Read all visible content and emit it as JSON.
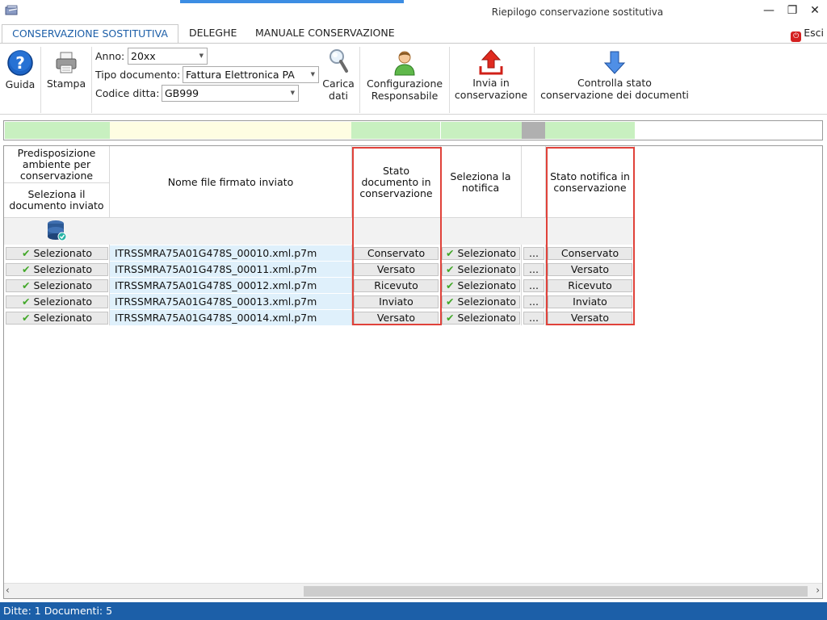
{
  "window": {
    "title": "Riepilogo conservazione sostitutiva",
    "minimize_glyph": "—",
    "restore_glyph": "❐",
    "close_glyph": "✕"
  },
  "tabs": [
    {
      "label": "CONSERVAZIONE SOSTITUTIVA",
      "active": true
    },
    {
      "label": "DELEGHE",
      "active": false
    },
    {
      "label": "MANUALE CONSERVAZIONE",
      "active": false
    }
  ],
  "esci_label": "Esci",
  "ribbon": {
    "guida_label": "Guida",
    "stampa_label": "Stampa",
    "anno_label": "Anno:",
    "anno_value": "20xx",
    "tipo_label": "Tipo documento:",
    "tipo_value": "Fattura Elettronica PA",
    "codice_label": "Codice ditta:",
    "codice_value": "GB999",
    "carica_label_1": "Carica",
    "carica_label_2": "dati",
    "configurazione_label_1": "Configurazione",
    "configurazione_label_2": "Responsabile",
    "invia_label_1": "Invia in",
    "invia_label_2": "conservazione",
    "controlla_label_1": "Controlla stato",
    "controlla_label_2": "conservazione dei documenti"
  },
  "grid": {
    "col_predisposizione": "Predisposizione ambiente per conservazione",
    "col_seleziona_documento": "Seleziona il documento inviato",
    "col_nome_file": "Nome file firmato inviato",
    "col_stato_documento": "Stato documento in conservazione",
    "col_seleziona_notifica": "Seleziona la notifica",
    "col_stato_notifica": "Stato notifica in conservazione",
    "rows": [
      {
        "selezione": "Selezionato",
        "file": "ITRSSMRA75A01G478S_00010.xml.p7m",
        "stato_documento": "Conservato",
        "notifica": "Selezionato",
        "more": "...",
        "stato_notifica": "Conservato"
      },
      {
        "selezione": "Selezionato",
        "file": "ITRSSMRA75A01G478S_00011.xml.p7m",
        "stato_documento": "Versato",
        "notifica": "Selezionato",
        "more": "...",
        "stato_notifica": "Versato"
      },
      {
        "selezione": "Selezionato",
        "file": "ITRSSMRA75A01G478S_00012.xml.p7m",
        "stato_documento": "Ricevuto",
        "notifica": "Selezionato",
        "more": "...",
        "stato_notifica": "Ricevuto"
      },
      {
        "selezione": "Selezionato",
        "file": "ITRSSMRA75A01G478S_00013.xml.p7m",
        "stato_documento": "Inviato",
        "notifica": "Selezionato",
        "more": "...",
        "stato_notifica": "Inviato"
      },
      {
        "selezione": "Selezionato",
        "file": "ITRSSMRA75A01G478S_00014.xml.p7m",
        "stato_documento": "Versato",
        "notifica": "Selezionato",
        "more": "...",
        "stato_notifica": "Versato"
      }
    ]
  },
  "statusbar": "Ditte: 1 Documenti: 5",
  "colors": {
    "accent": "#1c5fa8",
    "strip_green": "#c8f0c0",
    "strip_yellow": "#fefde2",
    "strip_gray": "#b0b0b0",
    "file_cell": "#dff0fb",
    "highlight": "#e0423a"
  }
}
